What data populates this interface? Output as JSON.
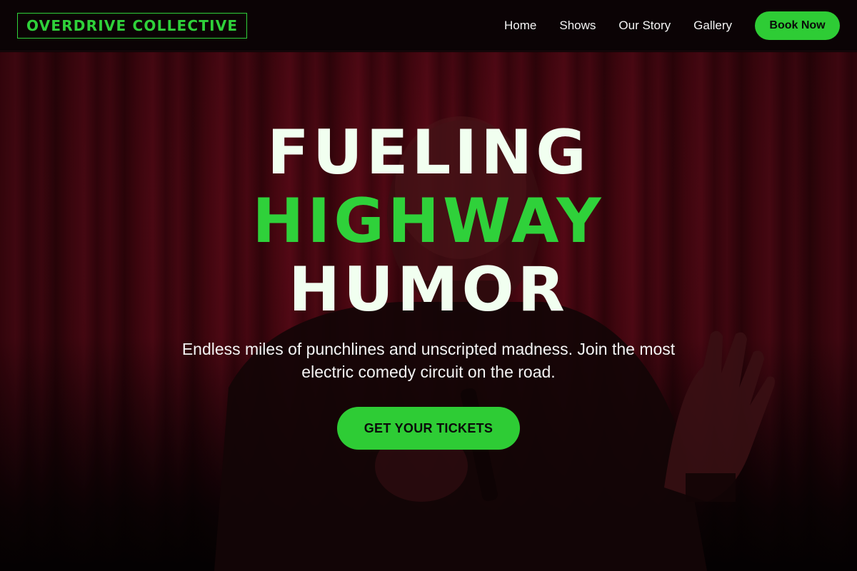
{
  "header": {
    "logo": "OVERDRIVE COLLECTIVE",
    "nav": [
      {
        "label": "Home"
      },
      {
        "label": "Shows"
      },
      {
        "label": "Our Story"
      },
      {
        "label": "Gallery"
      }
    ],
    "cta": "Book Now"
  },
  "hero": {
    "line1": "FUELING",
    "line2": "HIGHWAY",
    "line3": "HUMOR",
    "subtitle": "Endless miles of punchlines and unscripted madness. Join the most electric comedy circuit on the road.",
    "cta": "GET YOUR TICKETS"
  },
  "colors": {
    "accent": "#2ecc35",
    "background": "#0b0305",
    "curtain": "#5a0814",
    "headline_light": "#f1fff0"
  }
}
